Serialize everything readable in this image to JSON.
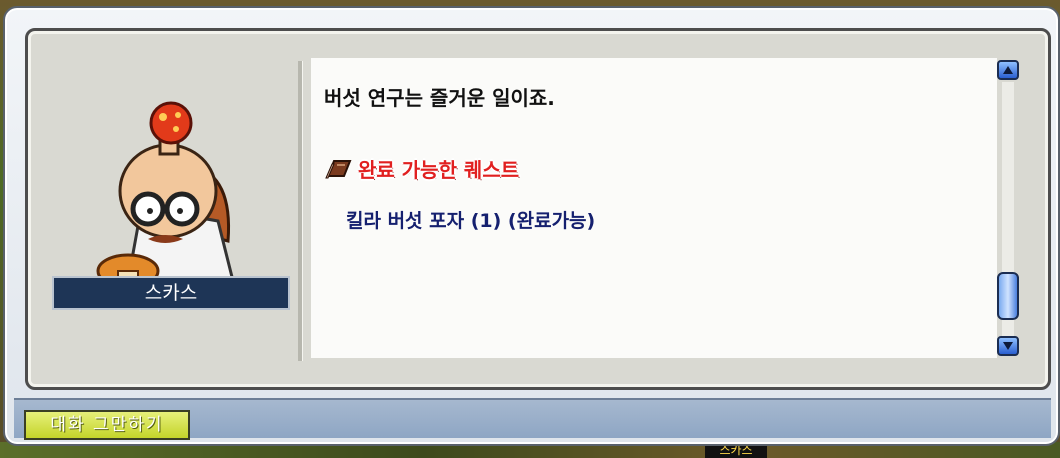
{
  "npc": {
    "name": "스카스"
  },
  "dialog": {
    "greeting": "버섯 연구는 즐거운 일이죠.",
    "quest_section_title": "완료 가능한 퀘스트",
    "quests": [
      {
        "label": "킬라 버섯 포자 (1) (완료가능)"
      }
    ]
  },
  "buttons": {
    "end_chat": "대화 그만하기"
  },
  "background": {
    "npc_tag": "스카스"
  },
  "icons": {
    "section": "book-icon",
    "scroll_up": "arrow-up-icon",
    "scroll_down": "arrow-down-icon"
  },
  "colors": {
    "quest_title": "#e12020",
    "quest_item": "#15206f",
    "name_plate": "#1e3556",
    "end_chat": "#c4d42a"
  },
  "scroll": {
    "position": 0.92
  }
}
